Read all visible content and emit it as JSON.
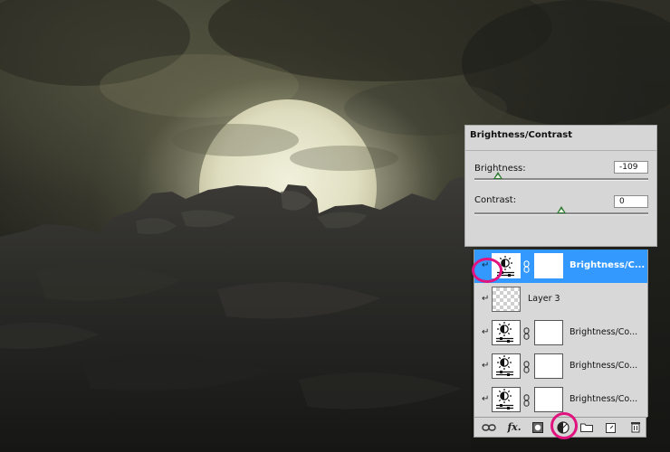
{
  "adjustment_panel": {
    "title": "Brightness/Contrast",
    "brightness": {
      "label": "Brightness:",
      "value": "-109",
      "slider_fraction": 0.135
    },
    "contrast": {
      "label": "Contrast:",
      "value": "0",
      "slider_fraction": 0.5
    }
  },
  "layers": [
    {
      "name": "Brightness/C...",
      "type": "adjustment",
      "selected": true,
      "clipped": true,
      "icon": "brightness-contrast-icon"
    },
    {
      "name": "Layer 3",
      "type": "raster",
      "selected": false,
      "clipped": true,
      "icon": "transparent-thumbnail"
    },
    {
      "name": "Brightness/Co...",
      "type": "adjustment",
      "selected": false,
      "clipped": true,
      "icon": "brightness-contrast-icon"
    },
    {
      "name": "Brightness/Co...",
      "type": "adjustment",
      "selected": false,
      "clipped": true,
      "icon": "brightness-contrast-icon"
    },
    {
      "name": "Brightness/Co...",
      "type": "adjustment",
      "selected": false,
      "clipped": true,
      "icon": "brightness-contrast-icon"
    }
  ],
  "toolbar": {
    "icons": [
      "link-layers-icon",
      "fx-icon",
      "add-mask-icon",
      "new-adjustment-layer-icon",
      "new-group-icon",
      "new-layer-icon",
      "delete-layer-icon"
    ],
    "fx_label": "fx."
  },
  "colors": {
    "selection": "#3399ff",
    "highlight_circle": "#e0137f",
    "slider_thumb": "#2f7a30"
  }
}
